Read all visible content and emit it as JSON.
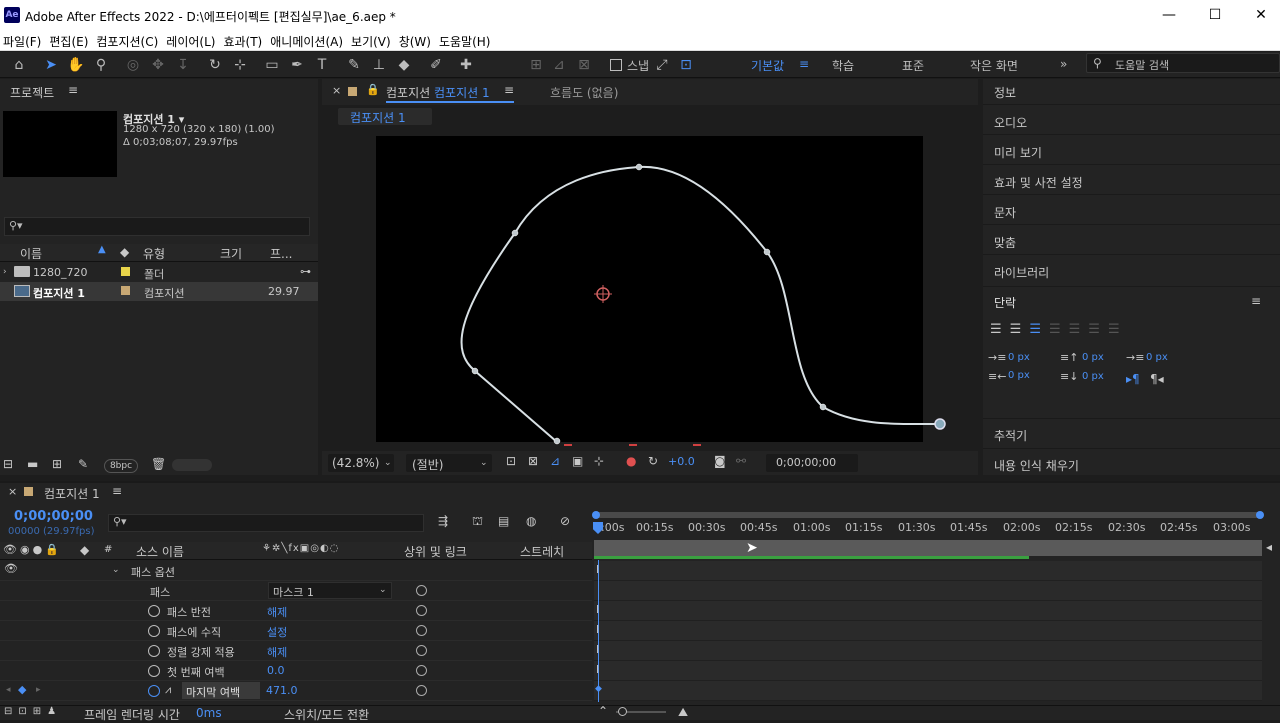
{
  "window": {
    "title": "Adobe After Effects 2022 - D:\\에프터이펙트 [편집실무]\\ae_6.aep *",
    "minimize": "—",
    "maximize": "☐",
    "close": "✕"
  },
  "menu": [
    "파일(F)",
    "편집(E)",
    "컴포지션(C)",
    "레이어(L)",
    "효과(T)",
    "애니메이션(A)",
    "보기(V)",
    "창(W)",
    "도움말(H)"
  ],
  "toolbar": {
    "snap_label": "스냅",
    "workspaces": [
      "기본값",
      "학습",
      "표준",
      "작은 화면"
    ],
    "active_workspace": "기본값",
    "search_placeholder": "도움말 검색"
  },
  "project": {
    "title": "프로젝트",
    "comp_name": "컴포지션 1 ▾",
    "comp_res": "1280 x 720  (320 x 180) (1.00)",
    "comp_dur": "Δ 0;03;08;07, 29.97fps",
    "columns": {
      "name": "이름",
      "type": "유형",
      "size": "크기",
      "fr": "프..."
    },
    "items": [
      {
        "name": "1280_720",
        "type": "폴더",
        "rate": "",
        "color": "#e8d44a"
      },
      {
        "name": "컴포지션 1",
        "type": "컴포지션",
        "rate": "29.97",
        "color": "#c8a874"
      }
    ],
    "bpc": "8bpc"
  },
  "viewer": {
    "tab_label": "컴포지션",
    "tab_comp": "컴포지션 1",
    "flow_tab": "흐름도 (없음)",
    "breadcrumb": "컴포지션 1",
    "zoom": "(42.8%)",
    "resolution": "(절반)",
    "exposure": "+0.0",
    "timecode": "0;00;00;00"
  },
  "right_panels": {
    "items": [
      "정보",
      "오디오",
      "미리 보기",
      "효과 및 사전 설정",
      "문자",
      "맞춤",
      "라이브러리"
    ],
    "paragraph_title": "단락",
    "indent_values": [
      "0 px",
      "0 px",
      "0 px",
      "0 px",
      "0 px"
    ],
    "bottom_items": [
      "추적기",
      "내용 인식 채우기"
    ]
  },
  "timeline": {
    "comp_tab": "컴포지션 1",
    "timecode": "0;00;00;00",
    "frames": "00000 (29.97fps)",
    "col_source": "소스 이름",
    "col_parent": "상위 및 링크",
    "col_stretch": "스트레치",
    "ruler": [
      "0:00s",
      "00:15s",
      "00:30s",
      "00:45s",
      "01:00s",
      "01:15s",
      "01:30s",
      "01:45s",
      "02:00s",
      "02:15s",
      "02:30s",
      "02:45s",
      "03:00s"
    ],
    "group": "패스 옵션",
    "properties": [
      {
        "name": "패스",
        "value": "마스크 1"
      },
      {
        "name": "패스 반전",
        "value": "해제"
      },
      {
        "name": "패스에 수직",
        "value": "설정"
      },
      {
        "name": "정렬 강제 적용",
        "value": "해제"
      },
      {
        "name": "첫 번째 여백",
        "value": "0.0"
      },
      {
        "name": "마지막 여백",
        "value": "471.0"
      }
    ],
    "footer_render": "프레임 렌더링 시간",
    "footer_render_value": "0ms",
    "footer_switch": "스위치/모드 전환"
  }
}
